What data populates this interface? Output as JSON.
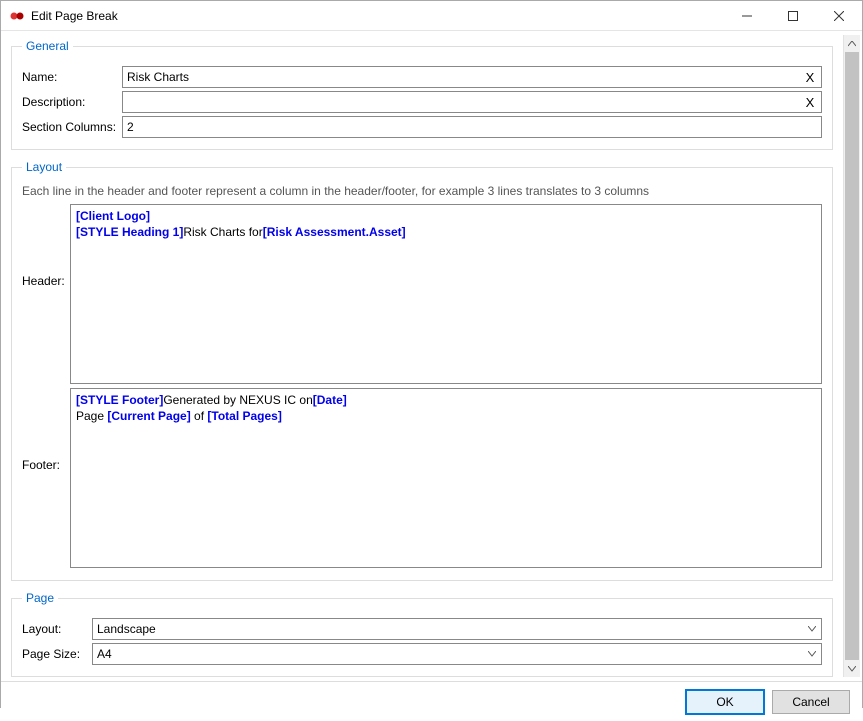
{
  "window": {
    "title": "Edit Page Break",
    "buttons": {
      "ok": "OK",
      "cancel": "Cancel"
    }
  },
  "general": {
    "legend": "General",
    "name_label": "Name:",
    "name_value": "Risk Charts",
    "description_label": "Description:",
    "description_value": "",
    "section_columns_label": "Section Columns:",
    "section_columns_value": "2",
    "clear": "X"
  },
  "layout": {
    "legend": "Layout",
    "hint": "Each line in the header and footer represent a column in the header/footer, for example 3 lines translates to 3 columns",
    "header_label": "Header:",
    "header_content": [
      {
        "t": "token",
        "v": "[Client Logo]"
      },
      {
        "t": "br"
      },
      {
        "t": "token",
        "v": "[STYLE Heading 1]"
      },
      {
        "t": "plain",
        "v": "Risk Charts for"
      },
      {
        "t": "token",
        "v": "[Risk Assessment.Asset]"
      }
    ],
    "footer_label": "Footer:",
    "footer_content": [
      {
        "t": "token",
        "v": "[STYLE Footer]"
      },
      {
        "t": "plain",
        "v": "Generated by NEXUS IC on"
      },
      {
        "t": "token",
        "v": "[Date]"
      },
      {
        "t": "br"
      },
      {
        "t": "plain",
        "v": "Page "
      },
      {
        "t": "token",
        "v": "[Current Page]"
      },
      {
        "t": "plain",
        "v": " of "
      },
      {
        "t": "token",
        "v": "[Total Pages]"
      }
    ]
  },
  "page": {
    "legend": "Page",
    "layout_label": "Layout:",
    "layout_value": "Landscape",
    "pagesize_label": "Page Size:",
    "pagesize_value": "A4"
  }
}
